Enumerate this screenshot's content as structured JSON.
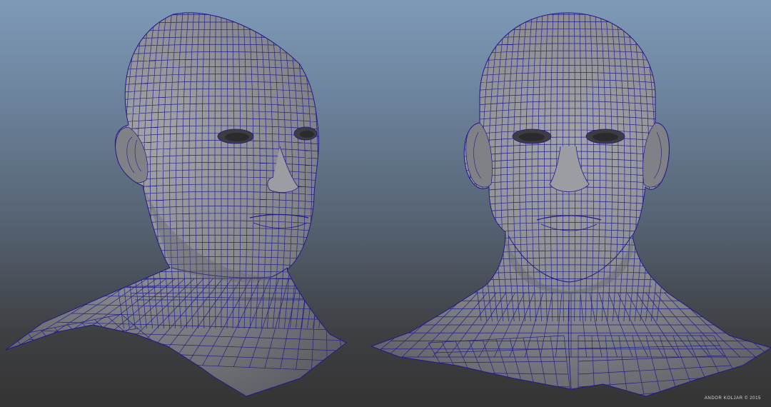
{
  "scene": {
    "credit": "ANDOR KOLJAR © 2015",
    "background_top": "#7e9ab8",
    "background_bottom": "#343434",
    "mesh_fill": "#8f9095",
    "mesh_shadow": "#58595e",
    "wire_color": "#1e1a8c",
    "models": [
      {
        "name": "head-three-quarter-view",
        "view": "three-quarter"
      },
      {
        "name": "head-front-view",
        "view": "front"
      }
    ]
  }
}
